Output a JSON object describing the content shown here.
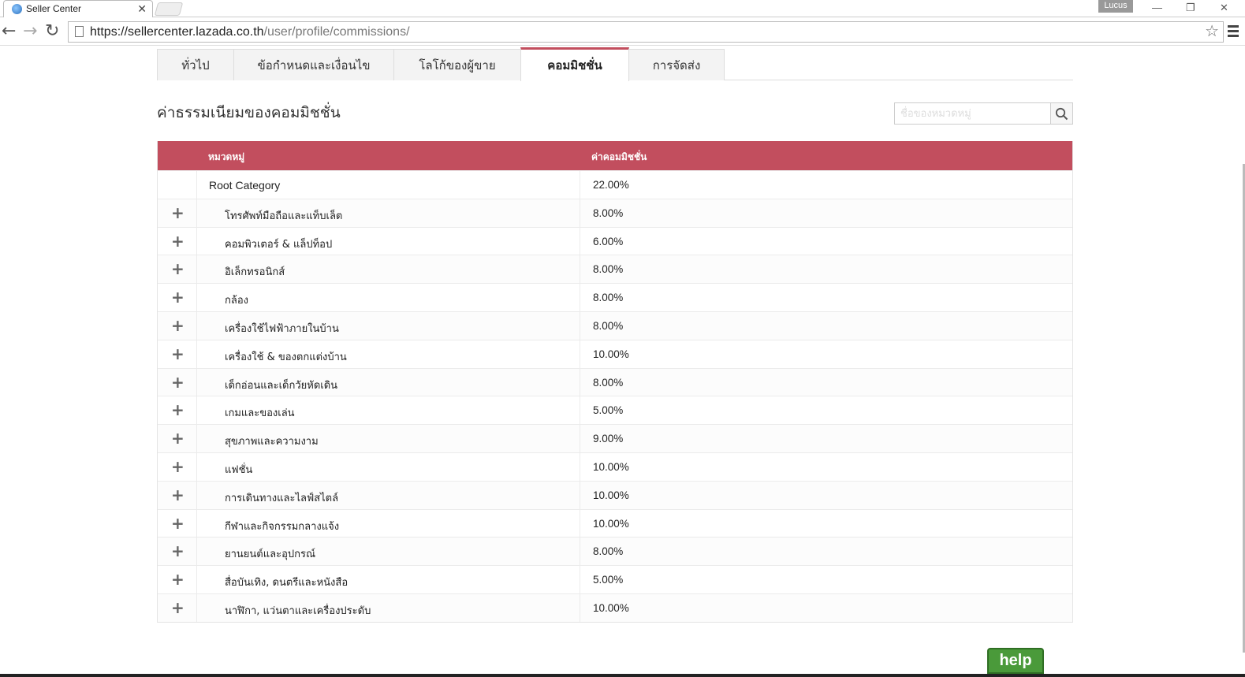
{
  "browser": {
    "tab_title": "Seller Center",
    "tab_close": "✕",
    "profile_name": "Lucus",
    "minimize": "—",
    "restore": "❐",
    "close": "✕",
    "back": "←",
    "forward": "→",
    "reload": "↻",
    "url_scheme_host": "https://sellercenter.lazada.co.th",
    "url_path": "/user/profile/commissions/",
    "star": "☆"
  },
  "page": {
    "tabs": [
      {
        "label": "ทั่วไป",
        "active": false
      },
      {
        "label": "ข้อกำหนดและเงื่อนไข",
        "active": false
      },
      {
        "label": "โลโก้ของผู้ขาย",
        "active": false
      },
      {
        "label": "คอมมิชชั่น",
        "active": true
      },
      {
        "label": "การจัดส่ง",
        "active": false
      }
    ],
    "section_title": "ค่าธรรมเนียมของคอมมิชชั่น",
    "search_placeholder": "ชื่อของหมวดหมู่",
    "table": {
      "header_category": "หมวดหมู่",
      "header_commission": "ค่าคอมมิชชั่น",
      "expand_symbol": "+",
      "rows": [
        {
          "category": "Root Category",
          "commission": "22.00%",
          "root": true
        },
        {
          "category": "โทรศัพท์มือถือและแท็บเล็ต",
          "commission": "8.00%"
        },
        {
          "category": "คอมพิวเตอร์ & แล็ปท็อป",
          "commission": "6.00%"
        },
        {
          "category": "อิเล็กทรอนิกส์",
          "commission": "8.00%"
        },
        {
          "category": "กล้อง",
          "commission": "8.00%"
        },
        {
          "category": "เครื่องใช้ไฟฟ้าภายในบ้าน",
          "commission": "8.00%"
        },
        {
          "category": "เครื่องใช้ & ของตกแต่งบ้าน",
          "commission": "10.00%"
        },
        {
          "category": "เด็กอ่อนและเด็กวัยหัดเดิน",
          "commission": "8.00%"
        },
        {
          "category": "เกมและของเล่น",
          "commission": "5.00%"
        },
        {
          "category": "สุขภาพและความงาม",
          "commission": "9.00%"
        },
        {
          "category": "แฟชั่น",
          "commission": "10.00%"
        },
        {
          "category": "การเดินทางและไลฟ์สไตล์",
          "commission": "10.00%"
        },
        {
          "category": "กีฬาและกิจกรรมกลางแจ้ง",
          "commission": "10.00%"
        },
        {
          "category": "ยานยนต์และอุปกรณ์",
          "commission": "8.00%"
        },
        {
          "category": "สื่อบันเทิง, ดนตรีและหนังสือ",
          "commission": "5.00%"
        },
        {
          "category": "นาฬิกา, แว่นตาและเครื่องประดับ",
          "commission": "10.00%"
        }
      ]
    },
    "help_label": "help"
  },
  "colors": {
    "accent": "#c24e5e",
    "help_green": "#4a9a3a"
  }
}
